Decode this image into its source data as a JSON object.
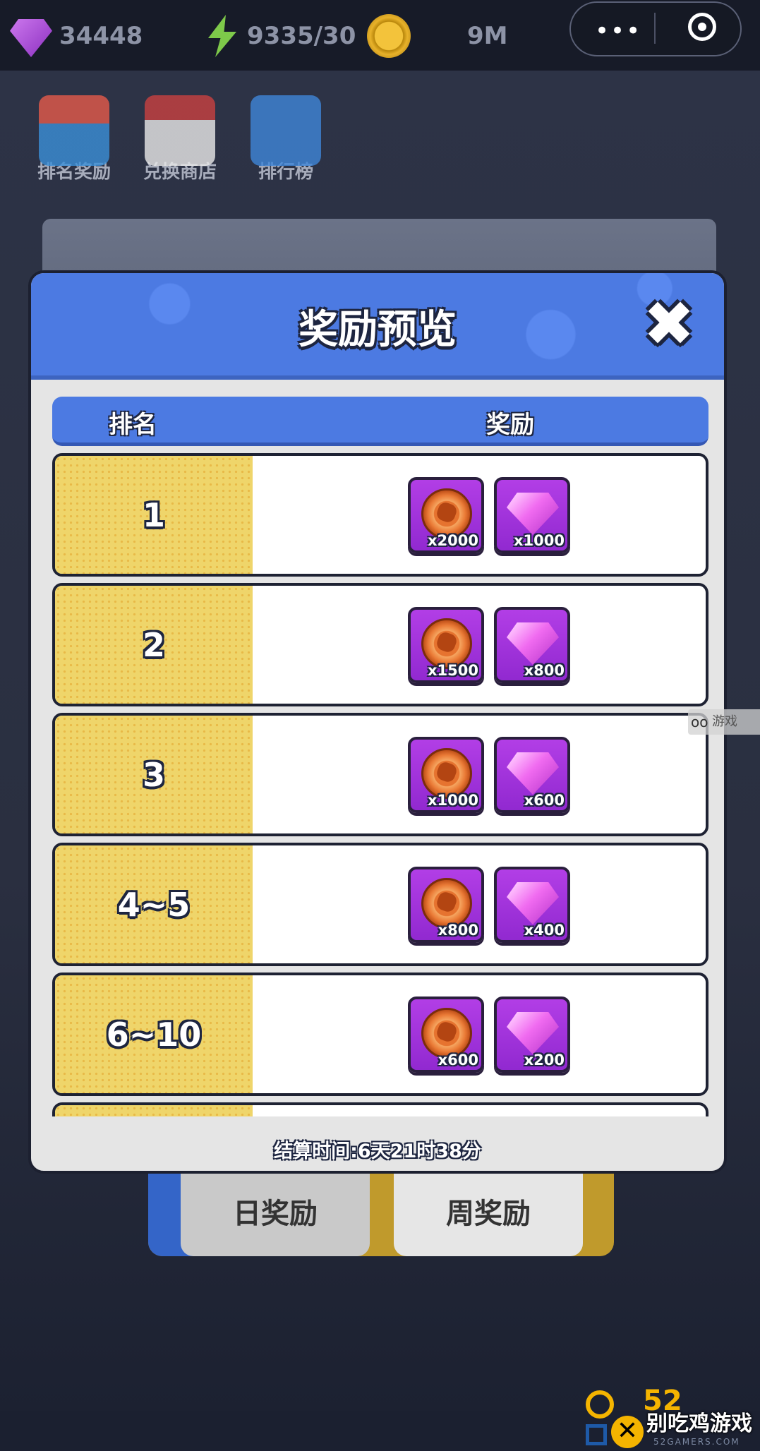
{
  "topbar": {
    "gems": "34448",
    "energy": "9335/30",
    "coins": "9M"
  },
  "quick_buttons": [
    {
      "label": "排名奖励",
      "icon": "gift-icon"
    },
    {
      "label": "兑换商店",
      "icon": "shop-icon"
    },
    {
      "label": "排行榜",
      "icon": "trophy-icon"
    }
  ],
  "dialog": {
    "title": "奖励预览",
    "col_rank": "排名",
    "col_reward": "奖励",
    "rows": [
      {
        "rank": "1",
        "coin_qty": "x2000",
        "gem_qty": "x1000"
      },
      {
        "rank": "2",
        "coin_qty": "x1500",
        "gem_qty": "x800"
      },
      {
        "rank": "3",
        "coin_qty": "x1000",
        "gem_qty": "x600"
      },
      {
        "rank": "4~5",
        "coin_qty": "x800",
        "gem_qty": "x400"
      },
      {
        "rank": "6~10",
        "coin_qty": "x600",
        "gem_qty": "x200"
      }
    ],
    "settle_time": "结算时间:6天21时38分"
  },
  "tabs": {
    "daily": "日奖励",
    "weekly": "周奖励"
  },
  "watermark": {
    "site_small": "游戏",
    "num": "52",
    "brand": "别吃鸡游戏",
    "domain": "52GAMERS.COM"
  },
  "colors": {
    "header_blue": "#4c7ae2",
    "rank_yellow": "#efd56a",
    "reward_purple": "#b23ee6"
  }
}
